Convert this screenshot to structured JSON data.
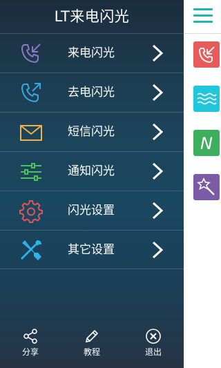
{
  "drawer": {
    "title": "LT来电闪光",
    "menu": [
      {
        "label": "来电闪光",
        "icon": "incoming-call-icon"
      },
      {
        "label": "去电闪光",
        "icon": "outgoing-call-icon"
      },
      {
        "label": "短信闪光",
        "icon": "envelope-icon"
      },
      {
        "label": "通知闪光",
        "icon": "sliders-icon"
      },
      {
        "label": "闪光设置",
        "icon": "gear-icon"
      },
      {
        "label": "其它设置",
        "icon": "tools-icon"
      }
    ],
    "bottom": {
      "share_label": "分享",
      "tutorial_label": "教程",
      "exit_label": "退出"
    }
  },
  "rail": {
    "menu_icon": "hamburger-icon",
    "tiles": [
      {
        "icon": "incoming-call-icon",
        "color": "#e85b5b"
      },
      {
        "icon": "waves-icon",
        "color": "#20c6dc"
      },
      {
        "icon": "letter-n-icon",
        "color": "#3dae5b",
        "text": "N"
      },
      {
        "icon": "magic-wand-icon",
        "color": "#7b5aa6"
      }
    ]
  },
  "colors": {
    "accent": "#1cb7b0",
    "drawer_top": "#1b2d3d",
    "drawer_mid": "#1a4760"
  }
}
